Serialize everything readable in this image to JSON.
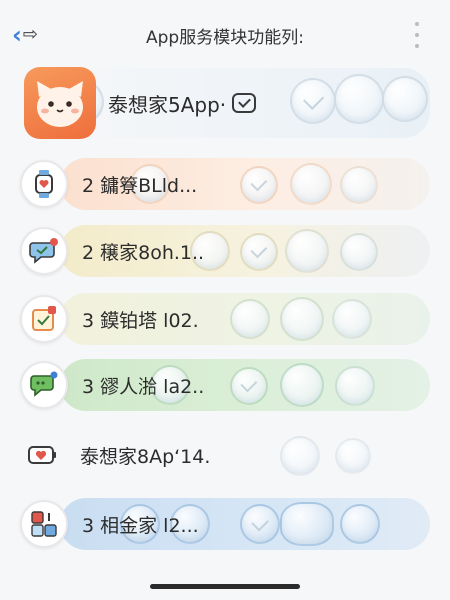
{
  "header": {
    "title": "App服务模块功能列:",
    "back_icon": "chevron-left-icon",
    "more_icon": "vertical-dots-icon"
  },
  "app": {
    "name": "泰想家5App·",
    "logo_icon": "cat-face-logo-icon",
    "status_icon": "watch-check-icon"
  },
  "modules": [
    {
      "label": "2 鏞簝BLld...",
      "icon": "watch-heart-icon",
      "accent": "#f3a478"
    },
    {
      "label": "2 穣家8oh.1..",
      "icon": "chat-check-icon",
      "accent": "#e2b93c"
    },
    {
      "label": "3 鏌铂塔 l02.",
      "icon": "calendar-check-icon",
      "accent": "#e58c4c"
    },
    {
      "label": "3 豂人湁 la2..",
      "icon": "chat-bubble-icon",
      "accent": "#5fae55"
    },
    {
      "label": "泰想家8Ap‘14.",
      "icon": "battery-heart-icon",
      "accent": "#e2574c"
    },
    {
      "label": "3 相金家 l2...",
      "icon": "blocks-icon",
      "accent": "#4e8fd4"
    }
  ],
  "colors": {
    "brand": "#ef7a44",
    "accent_blue": "#3f7fd6"
  }
}
